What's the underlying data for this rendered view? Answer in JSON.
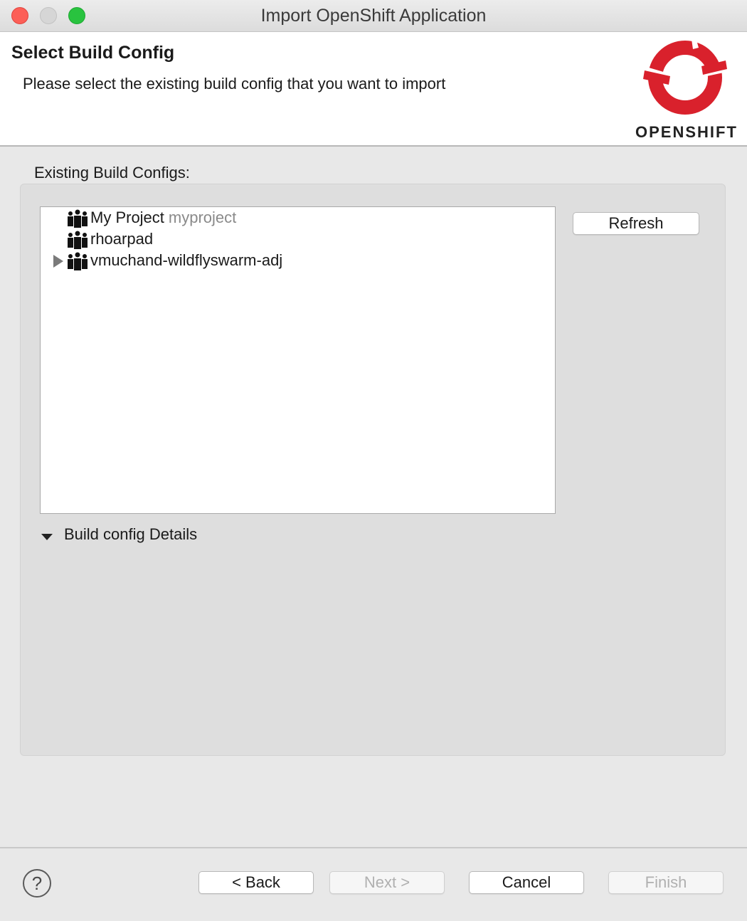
{
  "window": {
    "title": "Import OpenShift Application"
  },
  "header": {
    "title": "Select Build Config",
    "description": "Please select the existing build config that you want to import",
    "logo_text": "OPENSHIFT",
    "logo_color": "#d9212c"
  },
  "main": {
    "section_label": "Existing Build Configs:",
    "tree_items": [
      {
        "label": "My Project",
        "sublabel": "myproject",
        "expandable": false,
        "icon": "project-icon"
      },
      {
        "label": "rhoarpad",
        "sublabel": "",
        "expandable": false,
        "icon": "project-icon"
      },
      {
        "label": "vmuchand-wildflyswarm-adj",
        "sublabel": "",
        "expandable": true,
        "icon": "project-icon"
      }
    ],
    "refresh_label": "Refresh",
    "details_label": "Build config Details"
  },
  "footer": {
    "help_glyph": "?",
    "back_label": "< Back",
    "next_label": "Next >",
    "cancel_label": "Cancel",
    "finish_label": "Finish"
  }
}
